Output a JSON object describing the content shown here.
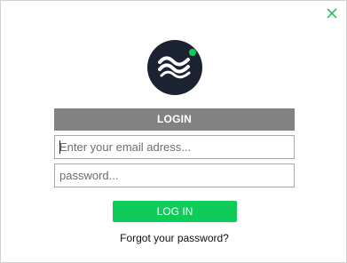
{
  "dialog": {
    "close_icon": "close-icon",
    "accent_color": "#0ecb5a",
    "logo": {
      "icon": "wave-logo-icon",
      "background_color": "#1b2332",
      "status_dot_color": "#0ecb5a"
    },
    "header": {
      "title": "LOGIN",
      "background_color": "#828282"
    },
    "email": {
      "placeholder": "Enter your email adress...",
      "value": ""
    },
    "password": {
      "placeholder": "password...",
      "value": ""
    },
    "login_button": {
      "label": "LOG IN"
    },
    "forgot_link": {
      "label": "Forgot your password?"
    }
  }
}
